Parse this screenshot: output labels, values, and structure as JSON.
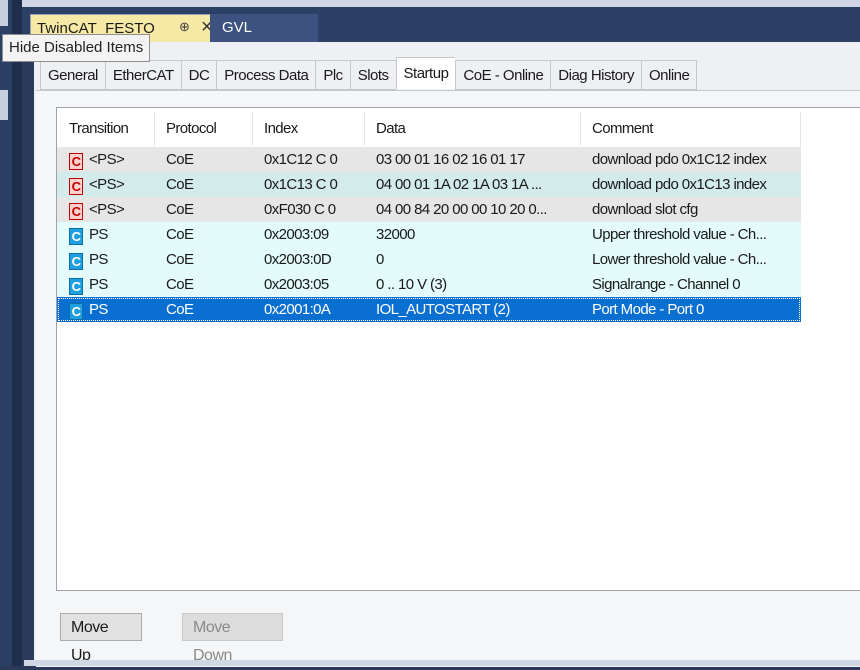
{
  "window": {
    "doc_tab_title": "TwinCAT_FESTO",
    "doc_tab_pin": "⊕",
    "gvl_tab_title": "GVL",
    "tooltip": "Hide Disabled Items"
  },
  "subtabs": [
    {
      "label": "General"
    },
    {
      "label": "EtherCAT"
    },
    {
      "label": "DC"
    },
    {
      "label": "Process Data"
    },
    {
      "label": "Plc"
    },
    {
      "label": "Slots"
    },
    {
      "label": "Startup",
      "active": true
    },
    {
      "label": "CoE - Online"
    },
    {
      "label": "Diag History"
    },
    {
      "label": "Online"
    }
  ],
  "table": {
    "columns": [
      "Transition",
      "Protocol",
      "Index",
      "Data",
      "Comment"
    ],
    "rows": [
      {
        "badge": "C",
        "badge_color": "red",
        "transition": "<PS>",
        "protocol": "CoE",
        "index": "0x1C12 C 0",
        "data": "03 00 01 16 02 16 01 17",
        "comment": "download pdo 0x1C12 index"
      },
      {
        "badge": "C",
        "badge_color": "red",
        "transition": "<PS>",
        "protocol": "CoE",
        "index": "0x1C13 C 0",
        "data": "04 00 01 1A 02 1A 03 1A ...",
        "comment": "download pdo 0x1C13 index"
      },
      {
        "badge": "C",
        "badge_color": "red",
        "transition": "<PS>",
        "protocol": "CoE",
        "index": "0xF030 C 0",
        "data": "04 00 84 20 00 00 10 20 0...",
        "comment": "download slot cfg"
      },
      {
        "badge": "C",
        "badge_color": "cyan",
        "transition": "PS",
        "protocol": "CoE",
        "index": "0x2003:09",
        "data": "32000",
        "comment": "Upper threshold value - Ch..."
      },
      {
        "badge": "C",
        "badge_color": "cyan",
        "transition": "PS",
        "protocol": "CoE",
        "index": "0x2003:0D",
        "data": "0",
        "comment": "Lower threshold value - Ch..."
      },
      {
        "badge": "C",
        "badge_color": "cyan",
        "transition": "PS",
        "protocol": "CoE",
        "index": "0x2003:05",
        "data": "0 .. 10 V (3)",
        "comment": "Signalrange - Channel 0"
      },
      {
        "badge": "C",
        "badge_color": "cyan",
        "transition": "PS",
        "protocol": "CoE",
        "index": "0x2001:0A",
        "data": "IOL_AUTOSTART (2)",
        "comment": "Port Mode - Port 0",
        "selected": true
      }
    ]
  },
  "buttons": {
    "move_up": "Move Up",
    "move_down": "Move Down"
  },
  "colors": {
    "selection": "#0a6fd1",
    "badge_red": "#c10000",
    "badge_cyan": "#1d9fe0",
    "doc_tab_bg": "#f6e9a6"
  }
}
